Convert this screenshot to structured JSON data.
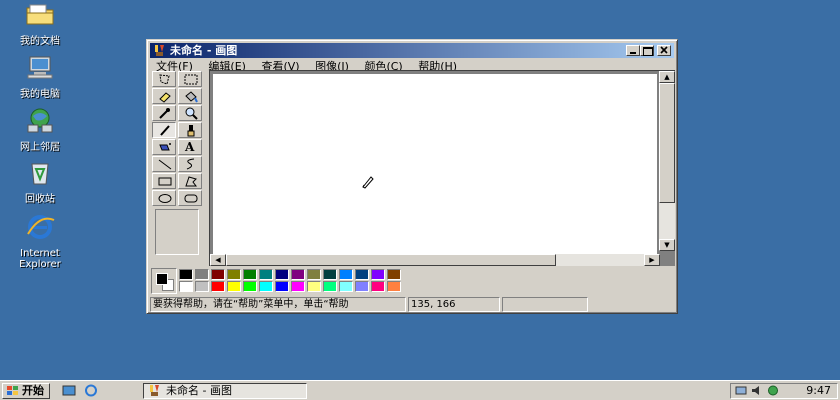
{
  "desktop": {
    "icons": [
      {
        "label": "我的文档",
        "icon": "my-documents-icon"
      },
      {
        "label": "我的电脑",
        "icon": "my-computer-icon"
      },
      {
        "label": "网上邻居",
        "icon": "network-places-icon"
      },
      {
        "label": "回收站",
        "icon": "recycle-bin-icon"
      },
      {
        "label_line1": "Internet",
        "label_line2": "Explorer",
        "icon": "internet-explorer-icon"
      }
    ]
  },
  "window": {
    "title": "未命名 - 画图",
    "title_icon": "paint-app-icon",
    "controls": [
      "minimize",
      "maximize",
      "close"
    ]
  },
  "menu": [
    {
      "label": "文件",
      "key": "F"
    },
    {
      "label": "编辑",
      "key": "E"
    },
    {
      "label": "查看",
      "key": "V"
    },
    {
      "label": "图像",
      "key": "I"
    },
    {
      "label": "颜色",
      "key": "C"
    },
    {
      "label": "帮助",
      "key": "H"
    }
  ],
  "tools": [
    {
      "name": "free-form-select",
      "selected": false
    },
    {
      "name": "select",
      "selected": false
    },
    {
      "name": "eraser",
      "selected": false
    },
    {
      "name": "fill-with-color",
      "selected": false
    },
    {
      "name": "pick-color",
      "selected": false
    },
    {
      "name": "magnifier",
      "selected": false
    },
    {
      "name": "pencil",
      "selected": true
    },
    {
      "name": "brush",
      "selected": false
    },
    {
      "name": "airbrush",
      "selected": false
    },
    {
      "name": "text",
      "selected": false,
      "glyph": "A"
    },
    {
      "name": "line",
      "selected": false
    },
    {
      "name": "curve",
      "selected": false
    },
    {
      "name": "rectangle",
      "selected": false
    },
    {
      "name": "polygon",
      "selected": false
    },
    {
      "name": "ellipse",
      "selected": false
    },
    {
      "name": "rounded-rectangle",
      "selected": false
    }
  ],
  "colors": {
    "foreground": "#000000",
    "background": "#ffffff",
    "top_row": [
      "#000000",
      "#808080",
      "#800000",
      "#808000",
      "#008000",
      "#008080",
      "#000080",
      "#800080",
      "#808040",
      "#004040",
      "#0080ff",
      "#004080",
      "#8000ff",
      "#804000"
    ],
    "bottom_row": [
      "#ffffff",
      "#c0c0c0",
      "#ff0000",
      "#ffff00",
      "#00ff00",
      "#00ffff",
      "#0000ff",
      "#ff00ff",
      "#ffff80",
      "#00ff80",
      "#80ffff",
      "#8080ff",
      "#ff0080",
      "#ff8040"
    ]
  },
  "status": {
    "help_text": "要获得帮助，请在“帮助”菜单中，单击“帮助",
    "coords": "135, 166"
  },
  "taskbar": {
    "start_label": "开始",
    "task_title": "未命名 - 画图",
    "clock": "9:47"
  }
}
